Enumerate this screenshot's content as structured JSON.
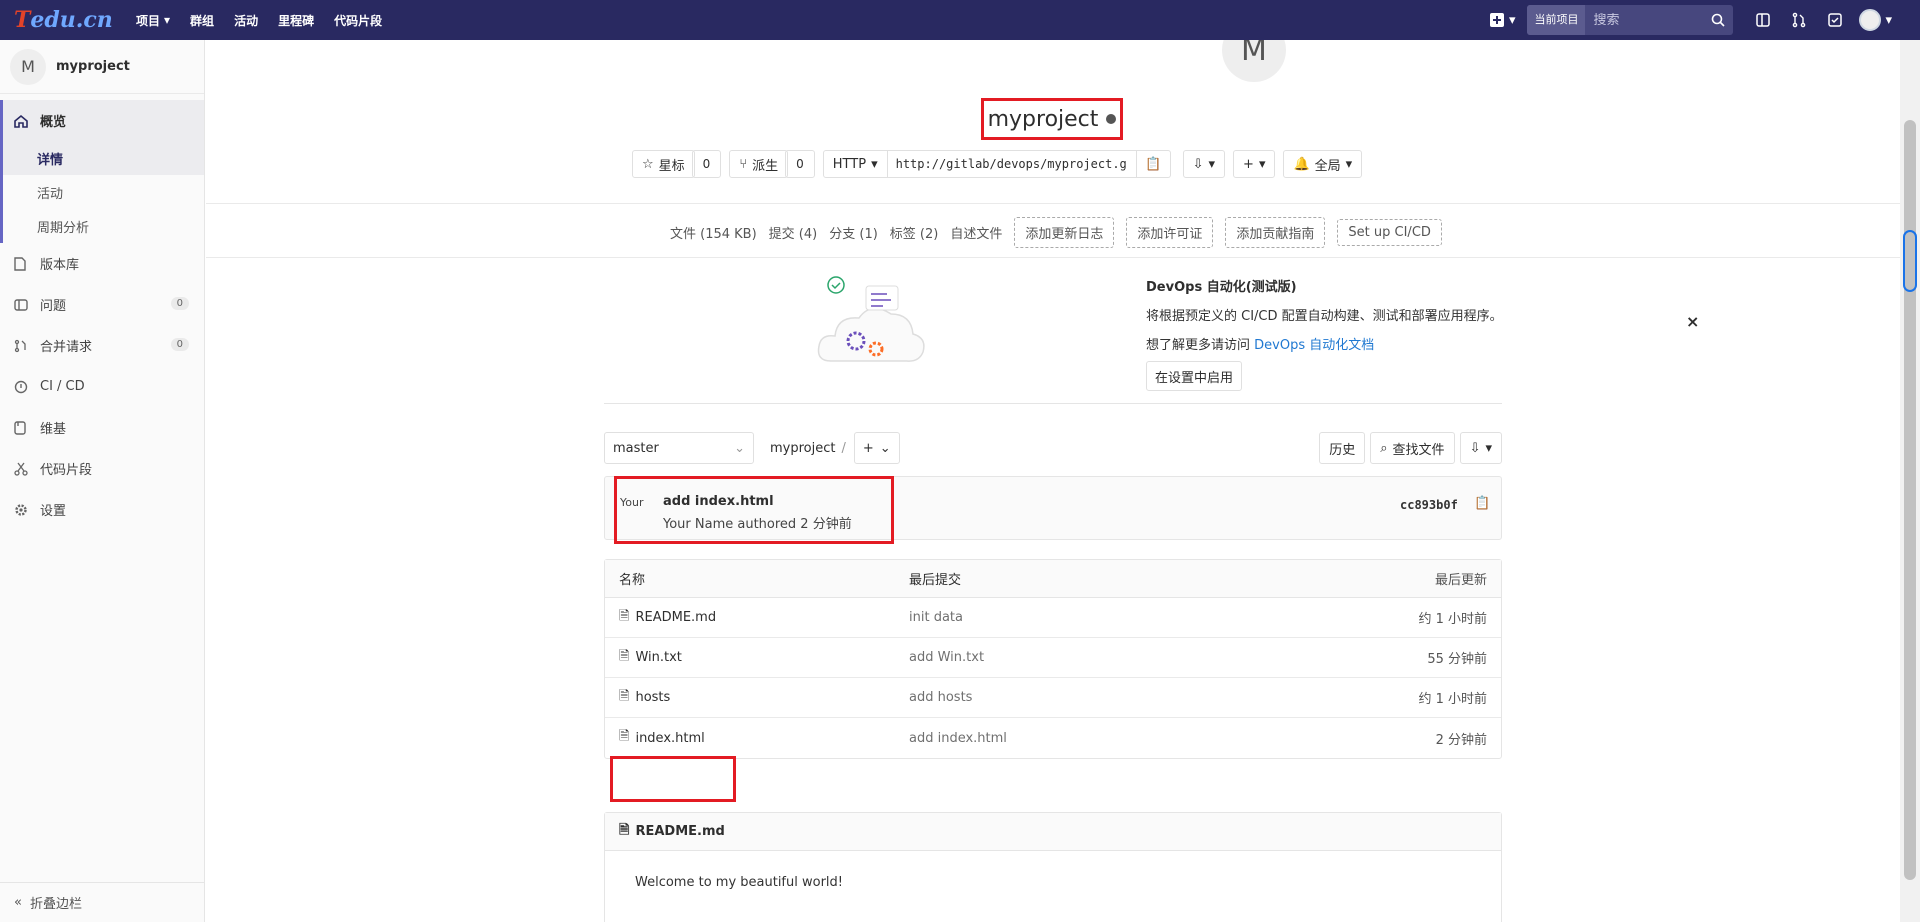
{
  "topbar": {
    "logo_a": "T",
    "logo_b": "edu.cn",
    "nav": [
      "项目",
      "群组",
      "活动",
      "里程碑",
      "代码片段"
    ],
    "scope": "当前项目",
    "search_placeholder": "搜索"
  },
  "sidebar": {
    "avatar_letter": "M",
    "project": "myproject",
    "overview": "概览",
    "sub": [
      "详情",
      "活动",
      "周期分析"
    ],
    "items": [
      {
        "label": "版本库"
      },
      {
        "label": "问题",
        "badge": "0"
      },
      {
        "label": "合并请求",
        "badge": "0"
      },
      {
        "label": "CI / CD"
      },
      {
        "label": "维基"
      },
      {
        "label": "代码片段"
      },
      {
        "label": "设置"
      }
    ],
    "collapse": "折叠边栏"
  },
  "project": {
    "avatar_letter": "M",
    "title": "myproject",
    "star_label": "星标",
    "star_count": "0",
    "fork_label": "派生",
    "fork_count": "0",
    "protocol": "HTTP",
    "clone_url": "http://gitlab/devops/myproject.g",
    "notify": "全局"
  },
  "stats": {
    "files": "文件 (154 KB)",
    "commits": "提交 (4)",
    "branches": "分支 (1)",
    "tags": "标签 (2)",
    "readme": "自述文件",
    "add_changelog": "添加更新日志",
    "add_license": "添加许可证",
    "add_contrib": "添加贡献指南",
    "setup_ci": "Set up CI/CD"
  },
  "promo": {
    "title": "DevOps 自动化(测试版)",
    "text": "将根据预定义的 CI/CD 配置自动构建、测试和部署应用程序。",
    "learn_prefix": "想了解更多请访问 ",
    "learn_link": "DevOps 自动化文档",
    "button": "在设置中启用",
    "close": "×"
  },
  "tree": {
    "branch": "master",
    "crumb": "myproject",
    "history": "历史",
    "find_file": "查找文件"
  },
  "commit": {
    "avatar_alt": "Your",
    "title": "add index.html",
    "meta": "Your Name authored 2 分钟前",
    "sha": "cc893b0f"
  },
  "table": {
    "headers": [
      "名称",
      "最后提交",
      "最后更新"
    ],
    "rows": [
      {
        "name": "README.md",
        "commit": "init data",
        "updated": "约 1 小时前"
      },
      {
        "name": "Win.txt",
        "commit": "add Win.txt",
        "updated": "55 分钟前"
      },
      {
        "name": "hosts",
        "commit": "add hosts",
        "updated": "约 1 小时前"
      },
      {
        "name": "index.html",
        "commit": "add index.html",
        "updated": "2 分钟前"
      }
    ]
  },
  "readme": {
    "file": "README.md",
    "content": "Welcome to my beautiful world!"
  },
  "colors": {
    "nav_bg": "#292961",
    "highlight": "#e31b23",
    "link": "#1f78d1"
  }
}
